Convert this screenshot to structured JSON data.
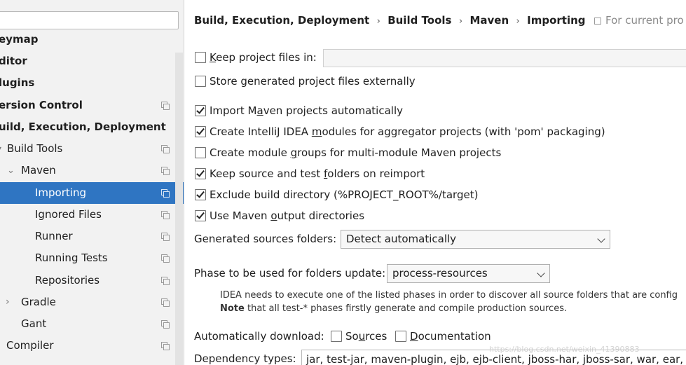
{
  "sidebar": {
    "search_value": "",
    "items": [
      {
        "label": "eymap",
        "bold": true
      },
      {
        "label": "ditor",
        "bold": true
      },
      {
        "label": "lugins",
        "bold": true
      },
      {
        "label": "ersion Control",
        "bold": true
      },
      {
        "label": "uild, Execution, Deployment",
        "bold": true
      },
      {
        "label": "Build Tools"
      },
      {
        "label": "Maven"
      },
      {
        "label": "Importing",
        "selected": true
      },
      {
        "label": "Ignored Files"
      },
      {
        "label": "Runner"
      },
      {
        "label": "Running Tests"
      },
      {
        "label": "Repositories"
      },
      {
        "label": "Gradle"
      },
      {
        "label": "Gant"
      },
      {
        "label": "Compiler"
      }
    ]
  },
  "breadcrumb": [
    "Build, Execution, Deployment",
    "Build Tools",
    "Maven",
    "Importing"
  ],
  "breadcrumb_separator": "›",
  "for_current_project": "For current pro",
  "options": {
    "keep_files": {
      "pre": "",
      "u": "K",
      "post": "eep project files in:",
      "checked": false
    },
    "store_external": {
      "pre": "Store generated project files externally",
      "u": "",
      "post": "",
      "checked": false
    },
    "import_auto": {
      "pre": "Import M",
      "u": "a",
      "post": "ven projects automatically",
      "checked": true
    },
    "create_modules": {
      "pre": "Create IntelliJ IDEA ",
      "u": "m",
      "post": "odules for aggregator projects (with 'pom' packaging)",
      "checked": true
    },
    "module_groups": {
      "pre": "Create module ",
      "u": "g",
      "post": "roups for multi-module Maven projects",
      "checked": false
    },
    "keep_source": {
      "pre": "Keep source and test ",
      "u": "f",
      "post": "olders on reimport",
      "checked": true
    },
    "exclude_build": {
      "pre": "Exclude build directory (%PROJECT_ROOT%/target)",
      "u": "",
      "post": "",
      "checked": true
    },
    "use_output": {
      "pre": "Use Maven ",
      "u": "o",
      "post": "utput directories",
      "checked": true
    }
  },
  "generated_sources": {
    "label": "Generated sources folders:",
    "value": "Detect automatically"
  },
  "phase": {
    "label": "Phase to be used for folders update:",
    "value": "process-resources"
  },
  "note": {
    "line1": "IDEA needs to execute one of the listed phases in order to discover all source folders that are config",
    "line2_bold": "Note",
    "line2_rest": " that all test-* phases firstly generate and compile production sources."
  },
  "auto_download": {
    "label": "Automatically download:",
    "sources": {
      "pre": "So",
      "u": "u",
      "post": "rces",
      "checked": false
    },
    "documentation": {
      "pre": "",
      "u": "D",
      "post": "ocumentation",
      "checked": false
    }
  },
  "dependency_types": {
    "label": "Dependency types:",
    "value": "jar, test-jar, maven-plugin, ejb, ejb-client, jboss-har, jboss-sar, war, ear, bun"
  },
  "watermark": "https://blog.csdn.net/weixin_41390883"
}
